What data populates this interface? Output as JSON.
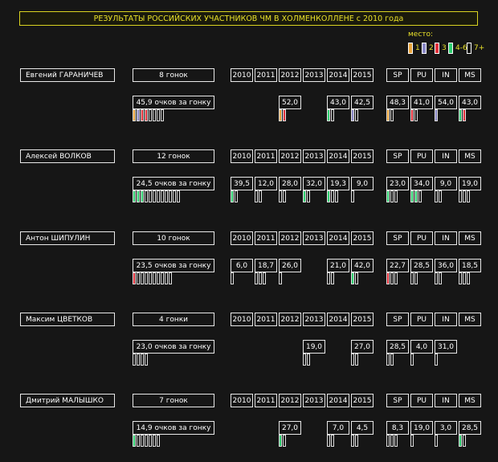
{
  "title": "РЕЗУЛЬТАТЫ РОССИЙСКИХ УЧАСТНИКОВ ЧМ В ХОЛМЕНКОЛЛЕНЕ с 2010 года",
  "legend": {
    "title": "место:",
    "items": [
      {
        "label": "1",
        "color": "#e9a33a"
      },
      {
        "label": "2",
        "color": "#8a88c6"
      },
      {
        "label": "3",
        "color": "#e2303a"
      },
      {
        "label": "4-6",
        "color": "#2fd070"
      },
      {
        "label": "7+",
        "color": "#161616"
      }
    ]
  },
  "colors": {
    "accent": "#e8e02a",
    "border": "#e8e8e8",
    "background": "#161616"
  },
  "chart_data": {
    "type": "table",
    "year_headers": [
      "2010",
      "2011",
      "2012",
      "2013",
      "2014",
      "2015"
    ],
    "discipline_headers": [
      "SP",
      "PU",
      "IN",
      "MS"
    ],
    "athletes": [
      {
        "name": "Евгений ГАРАНИЧЕВ",
        "races": "8 гонок",
        "points": "45,9 очков за гонку",
        "results": [
          "1",
          "2",
          "3",
          "3",
          "7+",
          "7+",
          "7+",
          "7+"
        ],
        "years": [
          {
            "value": "",
            "marks": []
          },
          {
            "value": "",
            "marks": []
          },
          {
            "value": "52,0",
            "marks": [
              "1",
              "3"
            ]
          },
          {
            "value": "",
            "marks": []
          },
          {
            "value": "43,0",
            "marks": [
              "4-6",
              "7+"
            ]
          },
          {
            "value": "42,5",
            "marks": [
              "2",
              "7+"
            ]
          }
        ],
        "disciplines": [
          {
            "value": "48,3",
            "marks": [
              "1",
              "7+"
            ]
          },
          {
            "value": "41,0",
            "marks": [
              "3",
              "7+"
            ]
          },
          {
            "value": "54,0",
            "marks": [
              "2"
            ]
          },
          {
            "value": "43,0",
            "marks": [
              "4-6",
              "3"
            ]
          }
        ]
      },
      {
        "name": "Алексей ВОЛКОВ",
        "races": "12 гонок",
        "points": "24,5 очков за гонку",
        "results": [
          "4-6",
          "4-6",
          "4-6",
          "7+",
          "7+",
          "7+",
          "7+",
          "7+",
          "7+",
          "7+",
          "7+",
          "7+"
        ],
        "years": [
          {
            "value": "39,5",
            "marks": [
              "4-6",
              "7+"
            ]
          },
          {
            "value": "12,0",
            "marks": [
              "7+",
              "7+"
            ]
          },
          {
            "value": "28,0",
            "marks": [
              "7+",
              "7+"
            ]
          },
          {
            "value": "32,0",
            "marks": [
              "4-6",
              "7+"
            ]
          },
          {
            "value": "19,3",
            "marks": [
              "4-6",
              "7+",
              "7+"
            ]
          },
          {
            "value": "9,0",
            "marks": [
              "7+"
            ]
          }
        ],
        "disciplines": [
          {
            "value": "23,0",
            "marks": [
              "4-6",
              "7+",
              "7+"
            ]
          },
          {
            "value": "34,0",
            "marks": [
              "4-6",
              "4-6",
              "7+"
            ]
          },
          {
            "value": "9,0",
            "marks": [
              "7+",
              "7+"
            ]
          },
          {
            "value": "19,0",
            "marks": [
              "7+",
              "7+",
              "7+"
            ]
          }
        ]
      },
      {
        "name": "Антон ШИПУЛИН",
        "races": "10 гонок",
        "points": "23,5 очков за гонку",
        "results": [
          "3",
          "7+",
          "7+",
          "7+",
          "7+",
          "7+",
          "7+",
          "7+",
          "7+",
          "7+"
        ],
        "years": [
          {
            "value": "6,0",
            "marks": [
              "7+"
            ]
          },
          {
            "value": "18,7",
            "marks": [
              "7+",
              "7+",
              "7+"
            ]
          },
          {
            "value": "26,0",
            "marks": [
              "7+"
            ]
          },
          {
            "value": "",
            "marks": []
          },
          {
            "value": "21,0",
            "marks": [
              "7+",
              "7+"
            ]
          },
          {
            "value": "42,0",
            "marks": [
              "4-6",
              "7+"
            ]
          }
        ],
        "disciplines": [
          {
            "value": "22,7",
            "marks": [
              "3",
              "7+",
              "7+"
            ]
          },
          {
            "value": "28,5",
            "marks": [
              "7+",
              "7+"
            ]
          },
          {
            "value": "36,0",
            "marks": [
              "7+",
              "7+"
            ]
          },
          {
            "value": "18,5",
            "marks": [
              "7+",
              "7+",
              "7+"
            ]
          }
        ]
      },
      {
        "name": "Максим ЦВЕТКОВ",
        "races": "4 гонки",
        "points": "23,0 очков за гонку",
        "results": [
          "7+",
          "7+",
          "7+",
          "7+"
        ],
        "years": [
          {
            "value": "",
            "marks": []
          },
          {
            "value": "",
            "marks": []
          },
          {
            "value": "",
            "marks": []
          },
          {
            "value": "19,0",
            "marks": [
              "7+",
              "7+"
            ]
          },
          {
            "value": "",
            "marks": []
          },
          {
            "value": "27,0",
            "marks": [
              "7+",
              "7+"
            ]
          }
        ],
        "disciplines": [
          {
            "value": "28,5",
            "marks": [
              "7+",
              "7+"
            ]
          },
          {
            "value": "4,0",
            "marks": [
              "7+"
            ]
          },
          {
            "value": "31,0",
            "marks": [
              "7+"
            ]
          },
          {
            "value": "",
            "marks": []
          }
        ]
      },
      {
        "name": "Дмитрий МАЛЫШКО",
        "races": "7 гонок",
        "points": "14,9 очков за гонку",
        "results": [
          "4-6",
          "7+",
          "7+",
          "7+",
          "7+",
          "7+",
          "7+"
        ],
        "years": [
          {
            "value": "",
            "marks": []
          },
          {
            "value": "",
            "marks": []
          },
          {
            "value": "27,0",
            "marks": [
              "4-6",
              "7+"
            ]
          },
          {
            "value": "",
            "marks": []
          },
          {
            "value": "7,0",
            "marks": [
              "7+",
              "7+"
            ]
          },
          {
            "value": "4,5",
            "marks": [
              "7+",
              "7+"
            ]
          }
        ],
        "disciplines": [
          {
            "value": "8,3",
            "marks": [
              "7+",
              "7+",
              "7+"
            ]
          },
          {
            "value": "19,0",
            "marks": [
              "7+"
            ]
          },
          {
            "value": "3,0",
            "marks": [
              "7+"
            ]
          },
          {
            "value": "28,5",
            "marks": [
              "4-6",
              "7+"
            ]
          }
        ]
      }
    ]
  }
}
